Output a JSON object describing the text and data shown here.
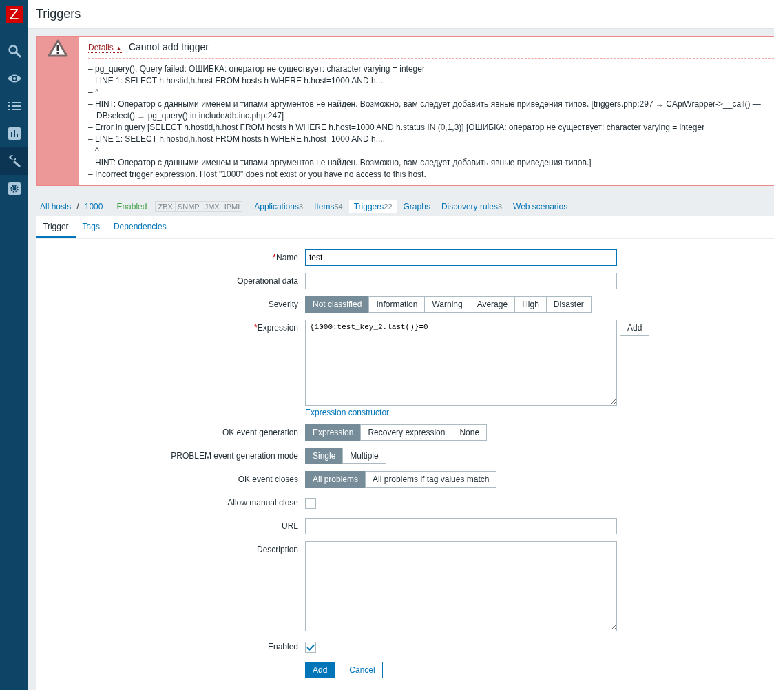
{
  "sidebar": {
    "logo": "Z",
    "items": [
      {
        "kind": "search",
        "selected": false
      },
      {
        "kind": "monitoring",
        "selected": false
      },
      {
        "kind": "inventory",
        "selected": false
      },
      {
        "kind": "reports",
        "selected": false
      },
      {
        "kind": "configuration",
        "selected": true
      },
      {
        "kind": "administration",
        "selected": false
      }
    ]
  },
  "page_title": "Triggers",
  "message": {
    "bullet": "–",
    "details_link": "Details",
    "details_arrow": "▲",
    "title": "Cannot add trigger",
    "lines": [
      {
        "text": "pg_query(): Query failed: ОШИБКА:  оператор не существует: character varying = integer"
      },
      {
        "text": "LINE 1: SELECT h.hostid,h.host FROM hosts h WHERE h.host=1000 AND h...."
      },
      {
        "text": "^"
      },
      {
        "text": "HINT:  Оператор с данными именем и типами аргументов не найден. Возможно, вам следует добавить явные приведения типов. [triggers.php:297 → CApiWrapper->__call() —",
        "continuation": "DBselect() → pg_query() in include/db.inc.php:247]"
      },
      {
        "text": "Error in query [SELECT h.hostid,h.host FROM hosts h WHERE h.host=1000 AND h.status IN (0,1,3)] [ОШИБКА:  оператор не существует: character varying = integer"
      },
      {
        "text": "LINE 1: SELECT h.hostid,h.host FROM hosts h WHERE h.host=1000 AND h...."
      },
      {
        "text": "^"
      },
      {
        "text": "HINT:  Оператор с данными именем и типами аргументов не найден. Возможно, вам следует добавить явные приведения типов.]"
      },
      {
        "text": "Incorrect trigger expression. Host \"1000\" does not exist or you have no access to this host."
      }
    ]
  },
  "host_nav": {
    "breadcrumbs": [
      "All hosts",
      "1000"
    ],
    "separator": "/",
    "status": "Enabled",
    "availability": [
      "ZBX",
      "SNMP",
      "JMX",
      "IPMI"
    ],
    "tabs": [
      {
        "label": "Applications",
        "count": "3",
        "selected": false
      },
      {
        "label": "Items",
        "count": "54",
        "selected": false
      },
      {
        "label": "Triggers",
        "count": "22",
        "selected": true
      },
      {
        "label": "Graphs",
        "selected": false
      },
      {
        "label": "Discovery rules",
        "count": "3",
        "selected": false
      },
      {
        "label": "Web scenarios",
        "selected": false
      }
    ]
  },
  "form_tabs": [
    {
      "label": "Trigger",
      "selected": true
    },
    {
      "label": "Tags",
      "selected": false
    },
    {
      "label": "Dependencies",
      "selected": false
    }
  ],
  "form": {
    "rows": [
      {
        "kind": "text",
        "label": "Name",
        "required_mark": "*",
        "value": "test"
      },
      {
        "kind": "text",
        "label": "Operational data"
      },
      {
        "kind": "segmented",
        "label": "Severity",
        "options": [
          {
            "label": "Not classified",
            "selected": true
          },
          {
            "label": "Information",
            "selected": false
          },
          {
            "label": "Warning",
            "selected": false
          },
          {
            "label": "Average",
            "selected": false
          },
          {
            "label": "High",
            "selected": false
          },
          {
            "label": "Disaster",
            "selected": false
          }
        ]
      },
      {
        "kind": "expression",
        "label": "Expression",
        "required_mark": "*",
        "value": "{1000:test_key_2.last()}=0",
        "button": "Add",
        "link": "Expression constructor"
      },
      {
        "kind": "segmented",
        "label": "OK event generation",
        "options": [
          {
            "label": "Expression",
            "selected": true
          },
          {
            "label": "Recovery expression",
            "selected": false
          },
          {
            "label": "None",
            "selected": false
          }
        ]
      },
      {
        "kind": "segmented",
        "label": "PROBLEM event generation mode",
        "options": [
          {
            "label": "Single",
            "selected": true
          },
          {
            "label": "Multiple",
            "selected": false
          }
        ]
      },
      {
        "kind": "segmented",
        "label": "OK event closes",
        "options": [
          {
            "label": "All problems",
            "selected": true
          },
          {
            "label": "All problems if tag values match",
            "selected": false
          }
        ]
      },
      {
        "kind": "checkbox",
        "label": "Allow manual close",
        "checked": false
      },
      {
        "kind": "text",
        "label": "URL"
      },
      {
        "kind": "textarea",
        "label": "Description"
      },
      {
        "kind": "checkbox",
        "label": "Enabled",
        "checked": true
      }
    ],
    "buttons": [
      {
        "label": "Add",
        "primary": true
      },
      {
        "label": "Cancel",
        "primary": false
      }
    ]
  }
}
